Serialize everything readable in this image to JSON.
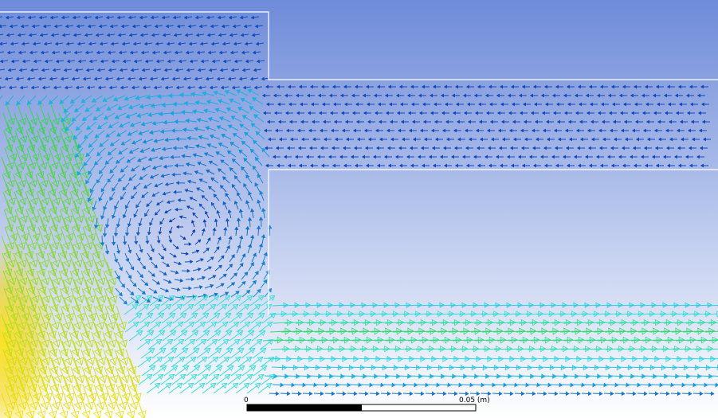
{
  "palette": {
    "background_top": "#6e8bd9",
    "background_bottom": "#ffffff",
    "boundary": "#ffffff",
    "velocity_low": "#0a2fb0",
    "velocity_mid_low": "#1aa6e0",
    "velocity_mid": "#30e0d8",
    "velocity_mid_high": "#35d845",
    "velocity_high": "#ffe000",
    "scale_bar": "#000000"
  },
  "scale_bar": {
    "start_label": "0",
    "end_label": "0.05 (m)"
  },
  "icons": [
    "velocity-vector-arrow"
  ]
}
